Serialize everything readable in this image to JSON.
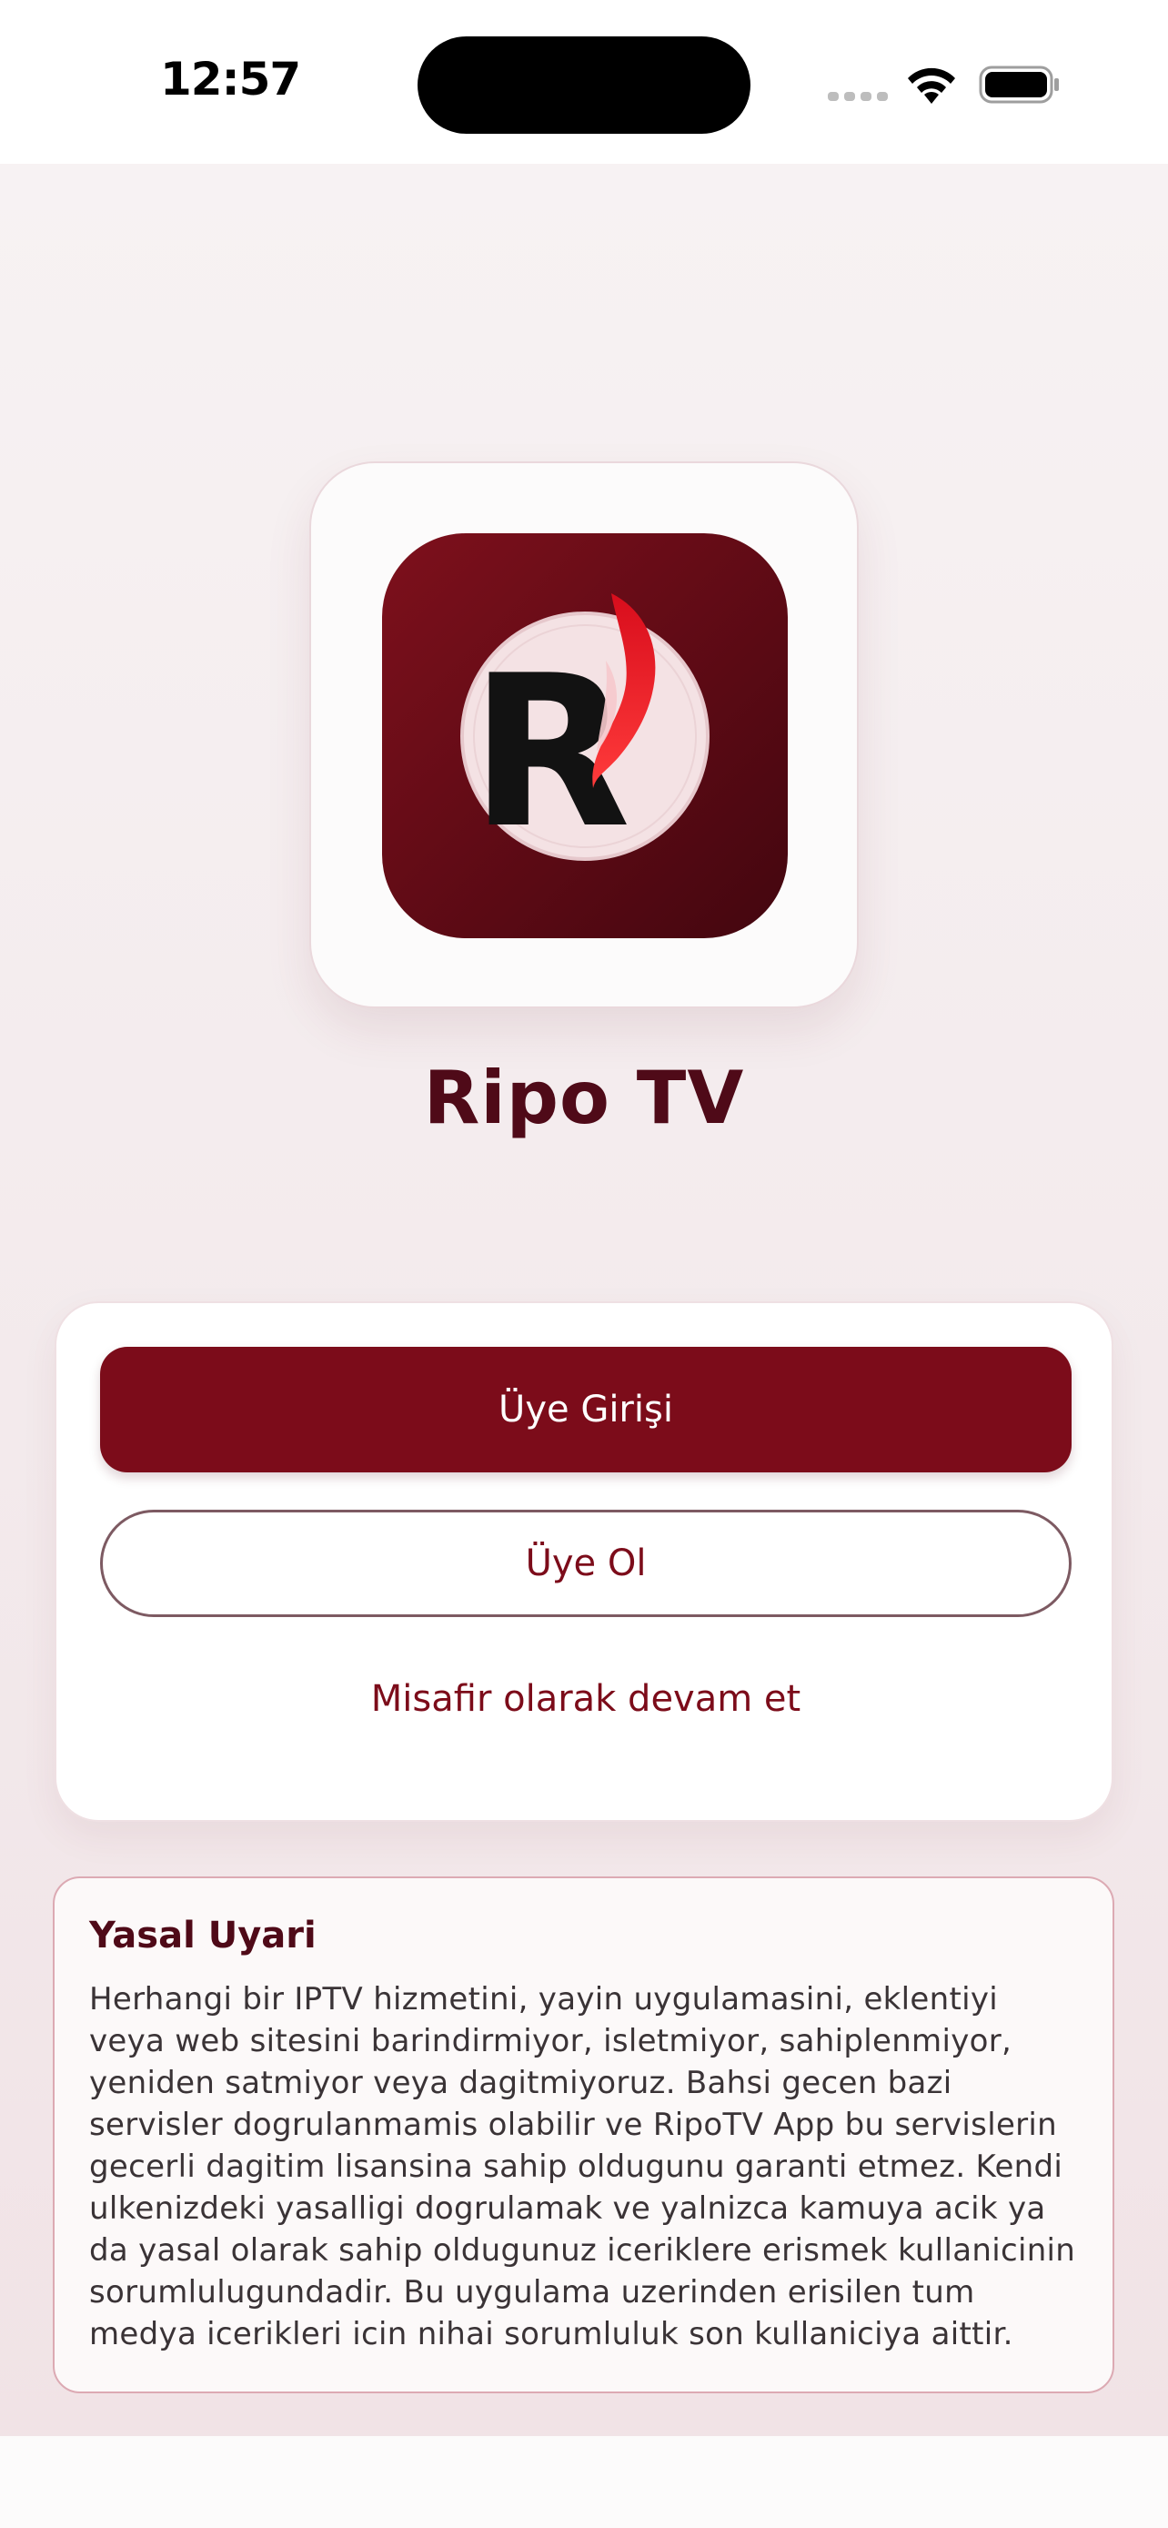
{
  "status_bar": {
    "time": "12:57",
    "icons": [
      "cellular-signal-icon",
      "wifi-icon",
      "battery-icon"
    ]
  },
  "app": {
    "logo_icon": "ripo-tv-logo",
    "logo_letter": "R",
    "title": "Ripo TV"
  },
  "auth": {
    "login_label": "Üye Girişi",
    "signup_label": "Üye Ol",
    "guest_label": "Misafir olarak devam et"
  },
  "legal": {
    "title": "Yasal Uyari",
    "body": "Herhangi bir IPTV hizmetini, yayin uygulamasini, eklentiyi veya web sitesini barindirmiyor, isletmiyor, sahiplenmiyor, yeniden satmiyor veya dagitmiyoruz. Bahsi gecen bazi servisler dogrulanmamis olabilir ve RipoTV App bu servislerin gecerli dagitim lisansina sahip oldugunu garanti etmez. Kendi ulkenizdeki yasalligi dogrulamak ve yalnizca kamuya acik ya da yasal olarak sahip oldugunuz iceriklere erismek kullanicinin sorumlulugundadir. Bu uygulama uzerinden erisilen tum medya icerikleri icin nihai sorumluluk son kullaniciya aittir."
  },
  "colors": {
    "brand": "#7c0c1a",
    "title": "#4f0a18",
    "background": "#f4ecee"
  }
}
